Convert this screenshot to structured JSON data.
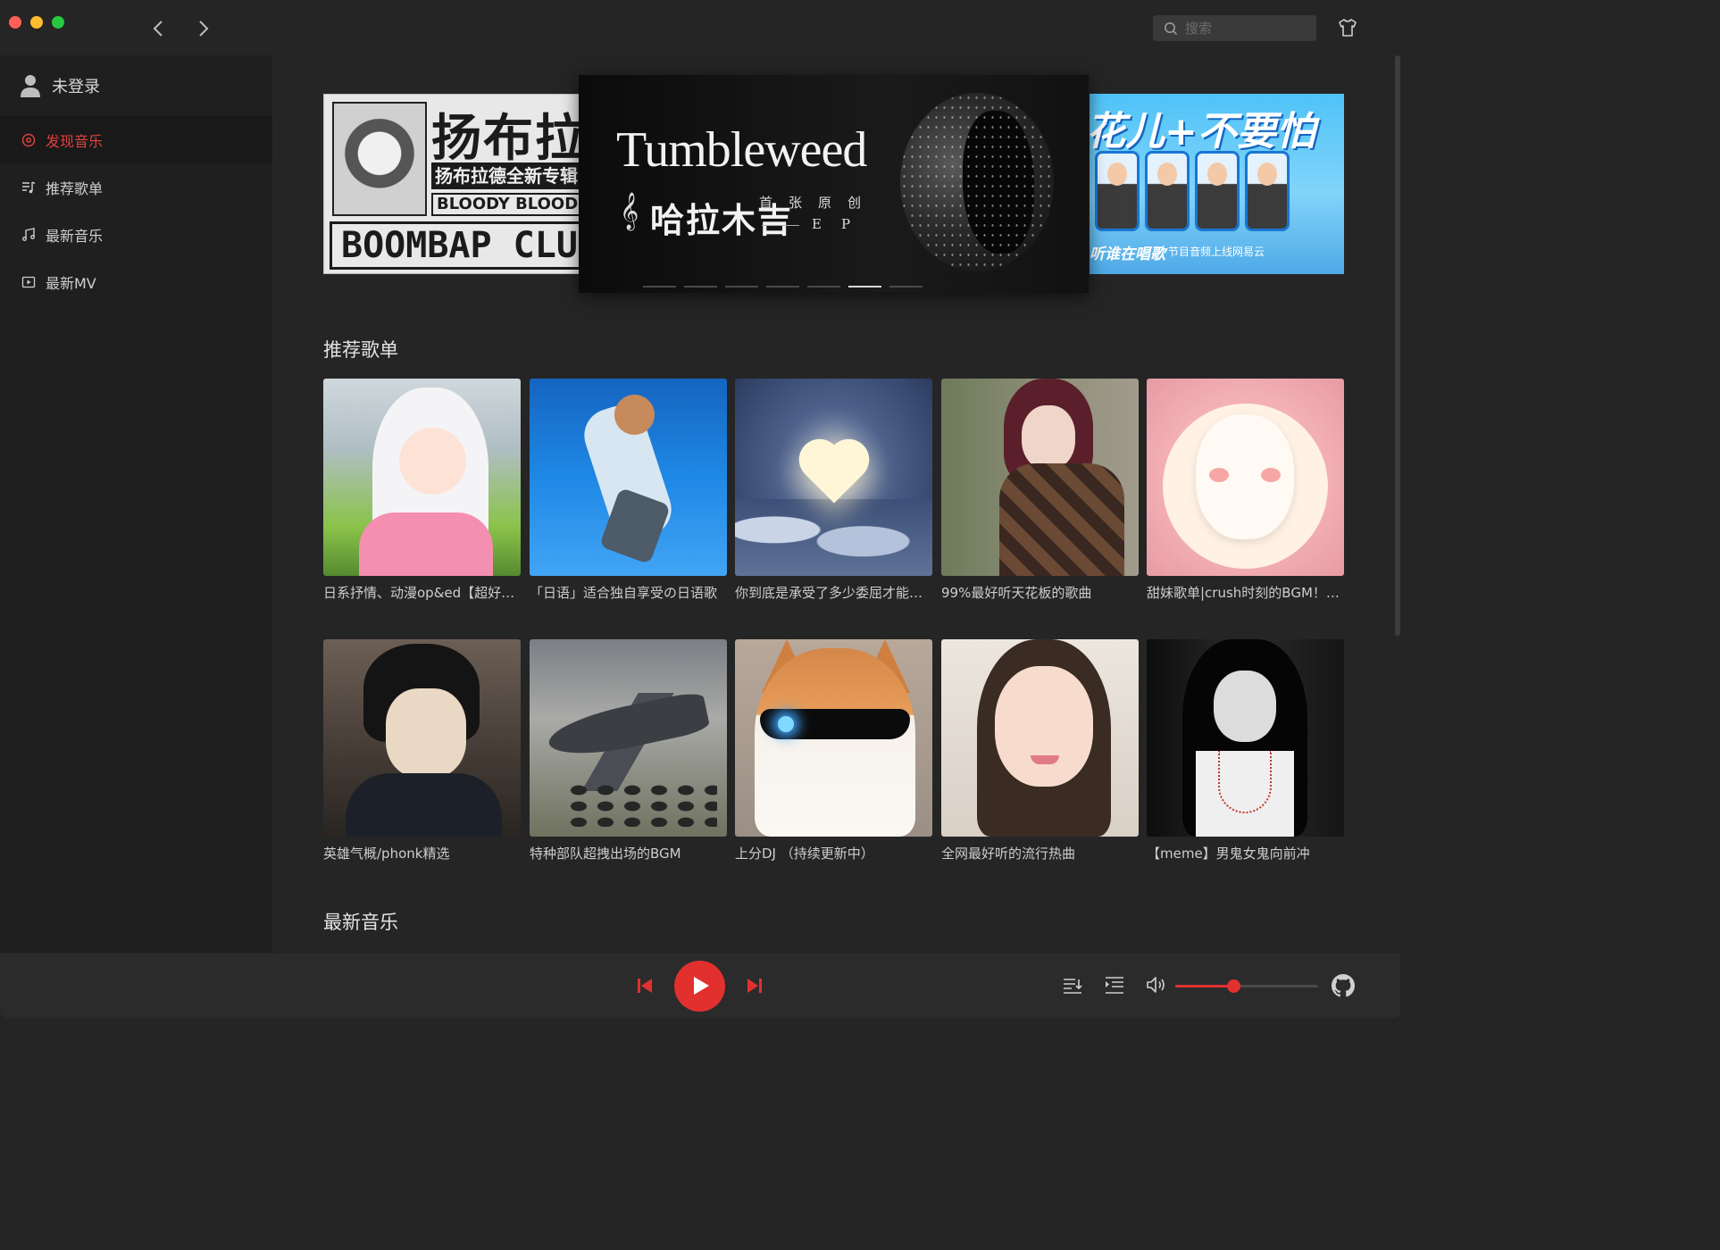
{
  "window": {
    "search_placeholder": "搜索"
  },
  "sidebar": {
    "user_label": "未登录",
    "items": [
      {
        "label": "发现音乐",
        "icon": "disc-icon",
        "active": true
      },
      {
        "label": "推荐歌单",
        "icon": "playlist-icon",
        "active": false
      },
      {
        "label": "最新音乐",
        "icon": "music-note-icon",
        "active": false
      },
      {
        "label": "最新MV",
        "icon": "video-icon",
        "active": false
      }
    ]
  },
  "banner": {
    "slides": {
      "left": {
        "title": "扬布拉德",
        "subtitle": "扬布拉德全新专辑",
        "tag": "BLOODY BLOOD STREAM",
        "bottom": "BOOMBAP CLUB"
      },
      "center": {
        "title": "Tumbleweed",
        "artist": "哈拉木吉",
        "ep_line1": "首张原创",
        "ep_line2": "EP"
      },
      "right": {
        "title": "花儿+不要怕",
        "caption_left": "听谁在唱歌",
        "caption_right": "节目音频上线网易云"
      }
    },
    "dot_count": 7,
    "active_dot": 5
  },
  "sections": {
    "recommended_title": "推荐歌单",
    "newest_title": "最新音乐"
  },
  "playlists": [
    {
      "name": "日系抒情、动漫op&ed【超好听…",
      "cover": "anime-girl-cover"
    },
    {
      "name": "「日语」适合独自享受の日语歌",
      "cover": "anime-sky-cover"
    },
    {
      "name": "你到底是承受了多少委屈才能如…",
      "cover": "heart-cloud-cover"
    },
    {
      "name": "99%最好听天花板的歌曲",
      "cover": "girl-portrait-cover"
    },
    {
      "name": "甜妹歌单|crush时刻的BGM！！！",
      "cover": "bunny-cake-cover"
    },
    {
      "name": "英雄气概/phonk精选",
      "cover": "anime-hero-cover"
    },
    {
      "name": "特种部队超拽出场的BGM",
      "cover": "fighter-jet-cover"
    },
    {
      "name": "上分DJ （持续更新中）",
      "cover": "cool-cat-cover"
    },
    {
      "name": "全网最好听的流行热曲",
      "cover": "smiling-girl-cover"
    },
    {
      "name": "【meme】男鬼女鬼向前冲",
      "cover": "ghost-boy-cover"
    }
  ],
  "player": {
    "volume": 0.41,
    "accent_color": "#e2302f"
  }
}
